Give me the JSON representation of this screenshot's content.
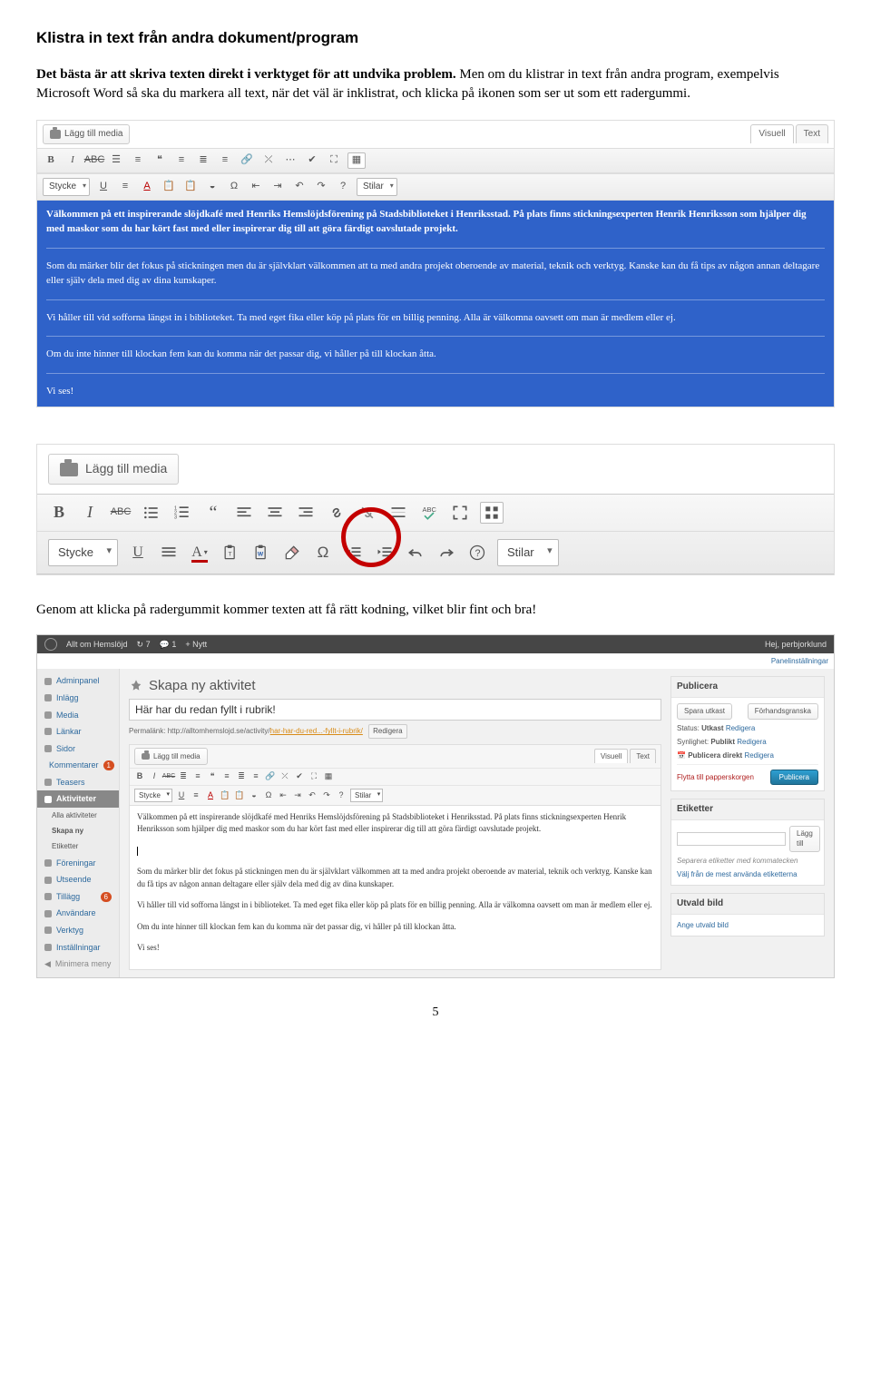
{
  "heading": "Klistra in text från andra dokument/program",
  "intro_bold": "Det bästa är att skriva texten direkt i verktyget för att undvika problem.",
  "intro_rest": " Men om du klistrar in text från andra program, exempelvis Microsoft Word så ska du markera all text, när det väl är inklistrat, och klicka på ikonen som ser ut som ett radergummi.",
  "shot1": {
    "add_media": "Lägg till media",
    "tab_visual": "Visuell",
    "tab_text": "Text",
    "style": "Stycke",
    "styles_dd": "Stilar",
    "p1": "Välkommen på ett inspirerande slöjdkafé med Henriks Hemslöjdsförening på Stadsbiblioteket i Henriksstad. På plats finns stickningsexperten Henrik Henriksson som hjälper dig med maskor som du har kört fast med eller inspirerar dig till att göra färdigt oavslutade projekt.",
    "p2": "Som du märker blir det fokus på stickningen men du är självklart välkommen att ta med andra projekt oberoende av material, teknik och verktyg. Kanske kan du få tips av någon annan deltagare eller själv dela med dig av dina kunskaper.",
    "p3": "Vi håller till vid sofforna längst in i biblioteket. Ta med eget fika eller köp på plats för en billig penning. Alla är välkomna oavsett om man är medlem eller ej.",
    "p4": "Om du inte hinner till klockan fem kan du komma när det passar dig, vi håller på till klockan åtta.",
    "p5": "Vi ses!"
  },
  "shot2": {
    "add_media": "Lägg till media",
    "style": "Stycke",
    "styles_dd": "Stilar"
  },
  "caption": "Genom att klicka på radergummit kommer texten att få rätt kodning, vilket blir fint och bra!",
  "wp": {
    "topbar": {
      "site": "Allt om Hemslöjd",
      "updates": "7",
      "comments": "1",
      "new": "+ Nytt",
      "greeting": "Hej, perbjorklund"
    },
    "panel_opt": "Panelinställningar",
    "side": {
      "admin": "Adminpanel",
      "posts": "Inlägg",
      "media": "Media",
      "links": "Länkar",
      "pages": "Sidor",
      "comments": "Kommentarer",
      "comments_n": "1",
      "teasers": "Teasers",
      "activities": "Aktiviteter",
      "all": "Alla aktiviteter",
      "new": "Skapa ny",
      "tags": "Etiketter",
      "associations": "Föreningar",
      "appearance": "Utseende",
      "plugins": "Tillägg",
      "plugins_n": "6",
      "users": "Användare",
      "tools": "Verktyg",
      "settings": "Inställningar",
      "collapse": "Minimera meny"
    },
    "main": {
      "h1": "Skapa ny aktivitet",
      "title": "Här har du redan fyllt i rubrik!",
      "permalink_pre": "Permalänk: ",
      "permalink_url": "http://alltomhemslojd.se/activity/",
      "permalink_slug": "har-har-du-red...-fyllt-i-rubrik/",
      "permalink_edit": "Redigera",
      "add_media": "Lägg till media",
      "tab_visual": "Visuell",
      "tab_text": "Text",
      "style": "Stycke",
      "styles_dd": "Stilar",
      "p1": "Välkommen på ett inspirerande slöjdkafé med Henriks Hemslöjdsförening på Stadsbiblioteket i Henriksstad. På plats finns stickningsexperten Henrik Henriksson som hjälper dig med maskor som du har kört fast med eller inspirerar dig till att göra färdigt oavslutade projekt.",
      "p2": "Som du märker blir det fokus på stickningen men du är självklart välkommen att ta med andra projekt oberoende av material, teknik och verktyg. Kanske kan du få tips av någon annan deltagare eller själv dela med dig av dina kunskaper.",
      "p3": "Vi håller till vid sofforna längst in i biblioteket. Ta med eget fika eller köp på plats för en billig penning. Alla är välkomna oavsett om man är medlem eller ej.",
      "p4": "Om du inte hinner till klockan fem kan du komma när det passar dig, vi håller på till klockan åtta.",
      "p5": "Vi ses!"
    },
    "publish": {
      "h": "Publicera",
      "save": "Spara utkast",
      "preview": "Förhandsgranska",
      "status_l": "Status:",
      "status_v": "Utkast",
      "edit": "Redigera",
      "vis_l": "Synlighet:",
      "vis_v": "Publikt",
      "sched": "Publicera direkt",
      "trash": "Flytta till papperskorgen",
      "publish": "Publicera"
    },
    "tags": {
      "h": "Etiketter",
      "add": "Lägg till",
      "sep": "Separera etiketter med kommatecken",
      "choose": "Välj från de mest använda etiketterna"
    },
    "featured": {
      "h": "Utvald bild",
      "set": "Ange utvald bild"
    }
  },
  "page_num": "5"
}
